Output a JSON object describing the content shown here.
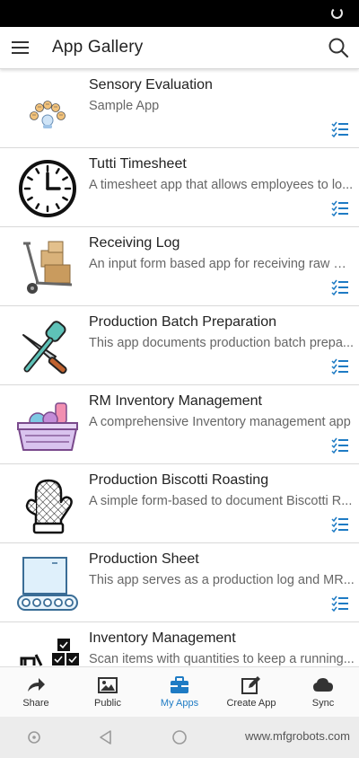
{
  "header": {
    "title": "App Gallery"
  },
  "apps": [
    {
      "name": "Sensory Evaluation",
      "description": "Sample App",
      "icon": "sensory-faces-icon"
    },
    {
      "name": "Tutti Timesheet",
      "description": "A timesheet app that allows employees to lo...",
      "icon": "clock-icon"
    },
    {
      "name": "Receiving Log",
      "description": "An input form based app for receiving raw m...",
      "icon": "hand-truck-icon"
    },
    {
      "name": "Production Batch Preparation",
      "description": "This app documents production batch prepa...",
      "icon": "utensils-icon"
    },
    {
      "name": "RM Inventory Management",
      "description": "A comprehensive Inventory management app",
      "icon": "basket-icon"
    },
    {
      "name": "Production Biscotti Roasting",
      "description": "A simple form-based to document Biscotti R...",
      "icon": "oven-mitt-icon"
    },
    {
      "name": "Production Sheet",
      "description": "This app serves as a production log and MR...",
      "icon": "conveyor-icon"
    },
    {
      "name": "Inventory Management",
      "description": "Scan items with quantities to keep a running...",
      "icon": "boxes-icon"
    }
  ],
  "bottom_nav": {
    "items": [
      {
        "label": "Share",
        "icon": "share-icon"
      },
      {
        "label": "Public",
        "icon": "image-icon"
      },
      {
        "label": "My Apps",
        "icon": "briefcase-icon"
      },
      {
        "label": "Create App",
        "icon": "edit-icon"
      },
      {
        "label": "Sync",
        "icon": "cloud-icon"
      }
    ],
    "active": "My Apps"
  },
  "watermark": "www.mfgrobots.com",
  "colors": {
    "accent": "#1e7bc4",
    "divider": "#d9d9d9",
    "status_bar": "#000000"
  }
}
